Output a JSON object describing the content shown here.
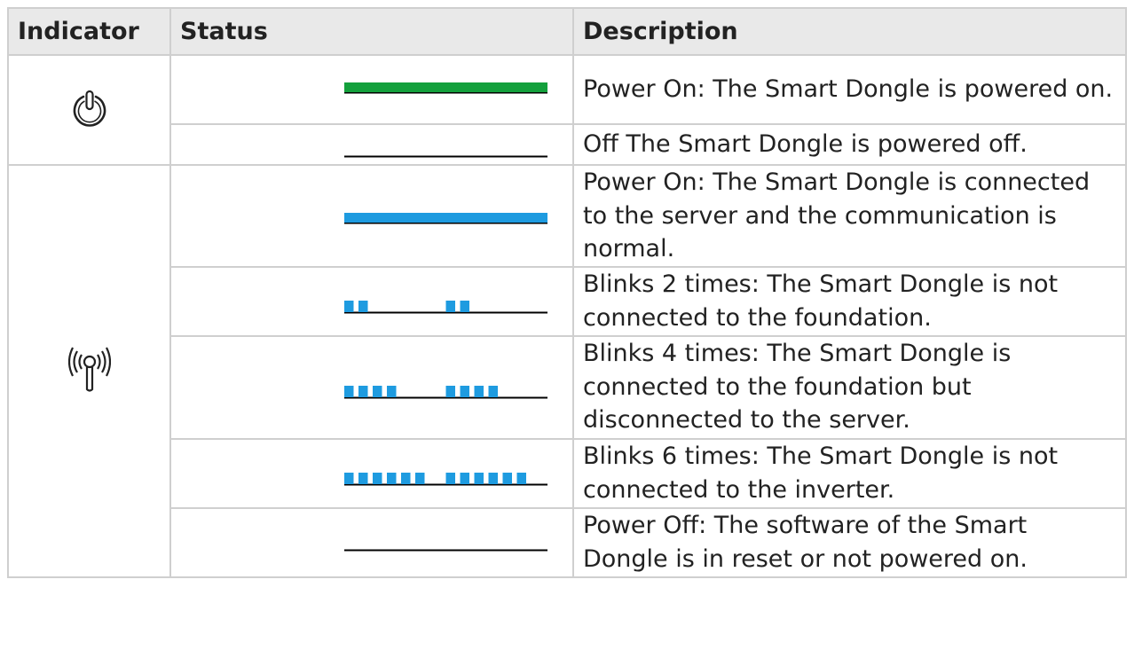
{
  "table": {
    "headers": [
      "Indicator",
      "Status",
      "Description"
    ],
    "groups": [
      {
        "icon": "power-icon",
        "rows": [
          {
            "signal": "solid-green",
            "color": "#14a03c",
            "description": "Power On: The Smart Dongle is powered on."
          },
          {
            "signal": "off",
            "color": "#000000",
            "description": "Off The Smart Dongle is powered off."
          }
        ]
      },
      {
        "icon": "wireless-signal-icon",
        "rows": [
          {
            "signal": "solid-blue",
            "color": "#1e9be0",
            "description": "Power On: The Smart Dongle is connected to the server and the communication is normal."
          },
          {
            "signal": "blink-2",
            "blinks": 2,
            "color": "#1e9be0",
            "description": "Blinks 2 times: The Smart Dongle is not connected to the foundation."
          },
          {
            "signal": "blink-4",
            "blinks": 4,
            "color": "#1e9be0",
            "description": "Blinks 4 times: The Smart Dongle is connected to the foundation but disconnected to the server."
          },
          {
            "signal": "blink-6",
            "blinks": 6,
            "color": "#1e9be0",
            "description": "Blinks 6 times: The Smart Dongle is not connected to the inverter."
          },
          {
            "signal": "off",
            "color": "#000000",
            "description": "Power Off: The software of the Smart Dongle is in reset or not powered on."
          }
        ]
      }
    ]
  }
}
